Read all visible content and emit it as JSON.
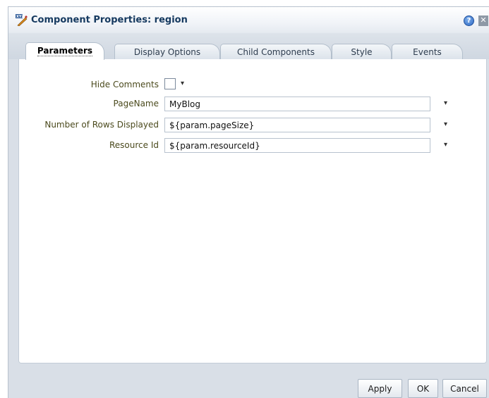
{
  "dialog": {
    "title": "Component Properties: region",
    "help_glyph": "?",
    "close_glyph": "✕"
  },
  "tabs": [
    {
      "label": "Parameters",
      "active": true
    },
    {
      "label": "Display Options",
      "active": false
    },
    {
      "label": "Child Components",
      "active": false
    },
    {
      "label": "Style",
      "active": false
    },
    {
      "label": "Events",
      "active": false
    }
  ],
  "params": {
    "hide_comments": {
      "label": "Hide Comments",
      "checked": false
    },
    "page_name": {
      "label": "PageName",
      "value": "MyBlog"
    },
    "rows_displayed": {
      "label": "Number of Rows Displayed",
      "value": "${param.pageSize}"
    },
    "resource_id": {
      "label": "Resource Id",
      "value": "${param.resourceId}"
    }
  },
  "dropdown_glyph": "▾",
  "buttons": {
    "apply": "Apply",
    "ok": "OK",
    "cancel": "Cancel"
  },
  "icons": {
    "title": "component-properties-icon",
    "help": "help-icon",
    "close": "close-icon"
  }
}
